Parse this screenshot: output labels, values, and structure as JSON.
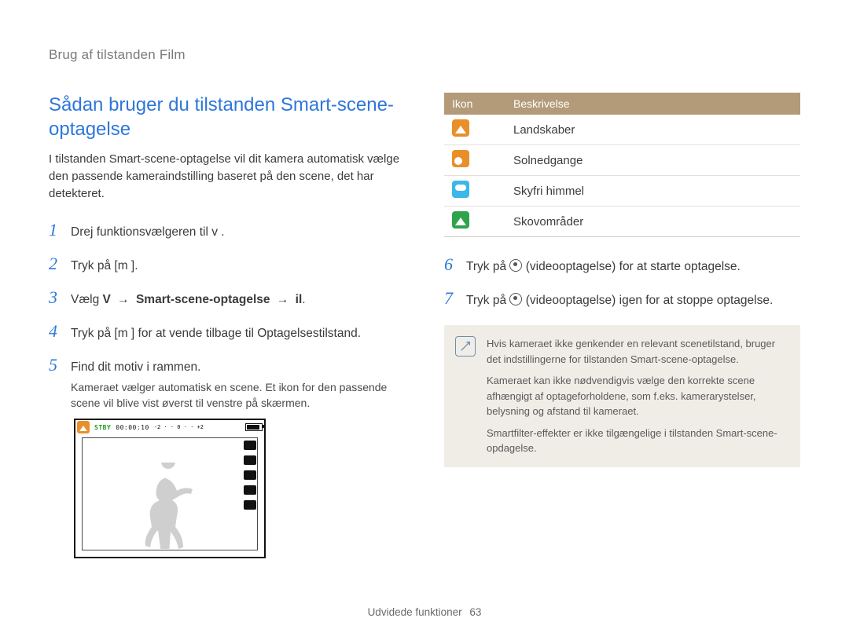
{
  "breadcrumb": "Brug af tilstanden Film",
  "title": "Sådan bruger du tilstanden Smart-scene-optagelse",
  "intro": "I tilstanden Smart-scene-optagelse vil dit kamera automatisk vælge den passende kameraindstilling baseret på den scene, det har detekteret.",
  "steps_left": [
    {
      "text": "Drej funktionsvælgeren til v    ."
    },
    {
      "text": "Tryk på [m      ]."
    },
    {
      "html_parts": {
        "prefix": "Vælg ",
        "v": "V",
        "arrow1": "→",
        "mid": "Smart-scene-optagelse",
        "arrow2": "→",
        "end": "il"
      }
    },
    {
      "text": "Tryk på [m      ] for at vende tilbage til Optagelsestilstand."
    },
    {
      "text": "Find dit motiv i rammen.",
      "sub": "Kameraet vælger automatisk en scene. Et ikon for den passende scene vil blive vist øverst til venstre på skærmen."
    }
  ],
  "steps_right": [
    {
      "text_before": "Tryk på ",
      "text_after": " (videooptagelse) for at starte optagelse."
    },
    {
      "text_before": "Tryk på ",
      "text_after": " (videooptagelse) igen for at stoppe optagelse."
    }
  ],
  "camera": {
    "stby": "STBY",
    "timecode": "00:00:10",
    "batt": "100"
  },
  "table": {
    "headers": [
      "Ikon",
      "Beskrivelse"
    ],
    "rows": [
      {
        "icon": "landscape",
        "desc": "Landskaber"
      },
      {
        "icon": "sunset",
        "desc": "Solnedgange"
      },
      {
        "icon": "sky",
        "desc": "Skyfri himmel"
      },
      {
        "icon": "forest",
        "desc": "Skovområder"
      }
    ]
  },
  "notes": [
    "Hvis kameraet ikke genkender en relevant scenetilstand, bruger det indstillingerne for tilstanden Smart-scene-optagelse.",
    "Kameraet kan ikke nødvendigvis vælge den korrekte scene afhængigt af optageforholdene, som f.eks. kamerarystelser, belysning og afstand til kameraet.",
    "Smartfilter-effekter er ikke tilgængelige i tilstanden Smart-scene-opdagelse."
  ],
  "footer": {
    "label": "Udvidede funktioner",
    "page": "63"
  }
}
